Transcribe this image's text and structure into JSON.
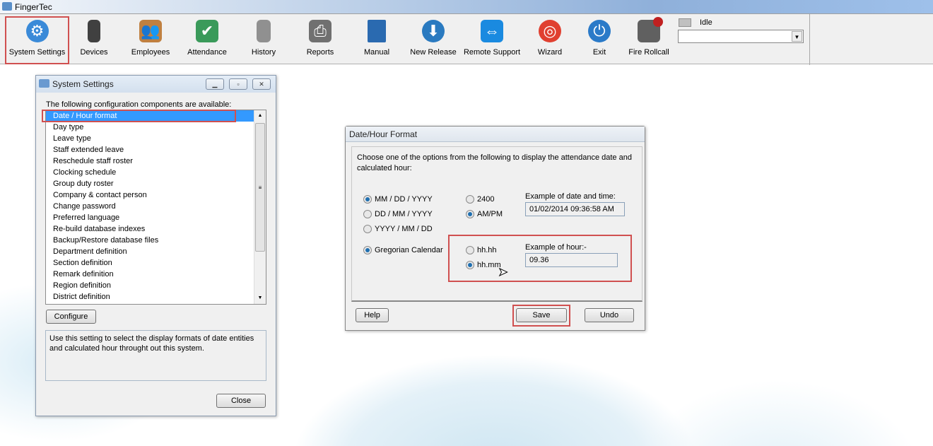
{
  "app": {
    "title": "FingerTec"
  },
  "toolbar": {
    "items": [
      {
        "label": "System Settings",
        "icon": "gear-icon",
        "color": "#3a8ad8"
      },
      {
        "label": "Devices",
        "icon": "device-icon",
        "color": "#404040"
      },
      {
        "label": "Employees",
        "icon": "employees-icon",
        "color": "#c08040"
      },
      {
        "label": "Attendance",
        "icon": "attendance-icon",
        "color": "#3a9a5a"
      },
      {
        "label": "History",
        "icon": "history-icon",
        "color": "#808080"
      },
      {
        "label": "Reports",
        "icon": "printer-icon",
        "color": "#707070"
      },
      {
        "label": "Manual",
        "icon": "book-icon",
        "color": "#2a6ab0"
      },
      {
        "label": "New Release",
        "icon": "globe-icon",
        "color": "#2a7ac0"
      },
      {
        "label": "Remote Support",
        "icon": "remote-icon",
        "color": "#1a8ae0"
      },
      {
        "label": "Wizard",
        "icon": "lifebuoy-icon",
        "color": "#e04030"
      },
      {
        "label": "Exit",
        "icon": "power-icon",
        "color": "#2a7ac8"
      },
      {
        "label": "Fire Rollcall",
        "icon": "fire-printer-icon",
        "color": "#c02020"
      }
    ],
    "status": "Idle",
    "combo_value": ""
  },
  "system_settings": {
    "title": "System Settings",
    "prompt": "The following configuration components are available:",
    "items": [
      "Date / Hour format",
      "Day type",
      "Leave type",
      "Staff extended leave",
      "Reschedule staff roster",
      "Clocking schedule",
      "Group duty roster",
      "Company & contact person",
      "Change password",
      "Preferred language",
      "Re-build database indexes",
      "Backup/Restore database files",
      "Department definition",
      "Section definition",
      "Remark definition",
      "Region definition",
      "District definition"
    ],
    "configure": "Configure",
    "description": "Use this setting to select the display formats of date entities and calculated hour throught out this system.",
    "close": "Close"
  },
  "date_hour": {
    "title": "Date/Hour Format",
    "instruction": "Choose one of the options from the following to display the attendance date and calculated hour:",
    "date_formats": [
      {
        "label": "MM / DD / YYYY",
        "checked": true
      },
      {
        "label": "DD / MM / YYYY",
        "checked": false
      },
      {
        "label": "YYYY / MM / DD",
        "checked": false
      }
    ],
    "time_formats": [
      {
        "label": "2400",
        "checked": false
      },
      {
        "label": "AM/PM",
        "checked": true
      }
    ],
    "calendar": {
      "label": "Gregorian Calendar",
      "checked": true
    },
    "hour_formats": [
      {
        "label": "hh.hh",
        "checked": false
      },
      {
        "label": "hh.mm",
        "checked": true
      }
    ],
    "example_date_label": "Example of date and time:",
    "example_date": "01/02/2014 09:36:58 AM",
    "example_hour_label": "Example of hour:-",
    "example_hour": "09.36",
    "help": "Help",
    "save": "Save",
    "undo": "Undo"
  }
}
